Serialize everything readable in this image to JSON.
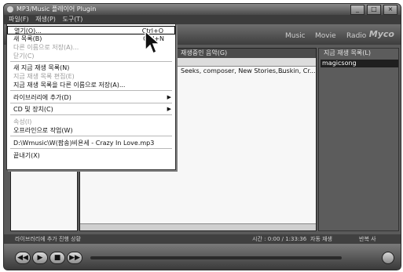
{
  "window": {
    "title": "MP3/Music 플레이어 Plugin",
    "buttons": [
      "_",
      "□",
      "×"
    ]
  },
  "menubar": {
    "items": [
      "파일(F)",
      "재생(P)",
      "도구(T)"
    ]
  },
  "toolbar": {
    "tabs": [
      "Music",
      "Movie",
      "Radio"
    ],
    "logo": "Myco"
  },
  "center": {
    "header": "재생중인 음악(G)",
    "row": {
      "title": "Seeks, composer, New Stories, ...",
      "meta": "Buskin, Cr..."
    }
  },
  "right": {
    "header": "지금 재생 목록(L)",
    "playlist": [
      "magicsong"
    ]
  },
  "status": {
    "left": "라이브러리에 추가 진행 상황",
    "time": "시간 : 0:00 / 1:33:36",
    "mode1": "자동 재생",
    "mode2": "반복 사"
  },
  "controls": {
    "prev": "◀◀",
    "play": "▶",
    "stop": "■",
    "next": "▶▶"
  },
  "context_menu": {
    "items": [
      {
        "label": "열기(O)...",
        "shortcut": "Ctrl+O",
        "disabled": false,
        "highlighted": true
      },
      {
        "label": "새 목록(B)",
        "shortcut": "Ctrl+N",
        "disabled": false
      },
      {
        "label": "다른 이름으로 저장(A)...",
        "shortcut": "",
        "disabled": true
      },
      {
        "label": "닫기(C)",
        "shortcut": "",
        "disabled": true
      },
      {
        "label": "새 지금 재생 목록(N)",
        "shortcut": "",
        "disabled": false
      },
      {
        "label": "지금 재생 목록 편집(E)",
        "shortcut": "",
        "disabled": true
      },
      {
        "label": "지금 재생 목록을 다른 이름으로 저장(A)...",
        "shortcut": "",
        "disabled": false
      },
      {
        "label": "라이브러리에 추가(D)",
        "arrow": "▶",
        "disabled": false
      },
      {
        "label": "CD 및 장치(C)",
        "arrow": "▶",
        "disabled": false
      },
      {
        "label": "속성(I)",
        "shortcut": "",
        "disabled": true
      },
      {
        "label": "오프라인으로 작업(W)",
        "shortcut": "",
        "disabled": false
      },
      {
        "label": "D:\\Wmusic\\W(팝송)비욘세 - Crazy In Love.mp3",
        "shortcut": "",
        "disabled": false
      },
      {
        "label": "끝내기(X)",
        "shortcut": "",
        "disabled": false
      }
    ]
  }
}
